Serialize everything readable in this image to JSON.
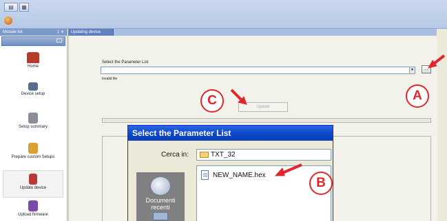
{
  "toolbar": {
    "icon": "app-icon"
  },
  "module_list": {
    "title": "Module list",
    "pin_label": "‡ ✕",
    "items": [
      {
        "label": "Home",
        "icon": "home-icon",
        "color": "#b83a2c"
      },
      {
        "label": "Device setup",
        "icon": "device-setup-icon",
        "color": "#5a6d8c"
      },
      {
        "label": "Setup summary",
        "icon": "summary-icon",
        "color": "#8a8f99"
      },
      {
        "label": "Prepare custom Setups",
        "icon": "custom-setup-icon",
        "color": "#d9a232"
      },
      {
        "label": "Update device",
        "icon": "update-device-icon",
        "color": "#b93a3a"
      },
      {
        "label": "Upload firmware",
        "icon": "upload-firmware-icon",
        "color": "#7a4aa8"
      }
    ]
  },
  "tab": {
    "label": "Updating device"
  },
  "update_pane": {
    "select_label": "Select the Parameter List",
    "combo_value": "",
    "combo_arrow": "▾",
    "browse_label": "...",
    "invalid_text": "Invalid file",
    "update_button": "Update"
  },
  "dialog": {
    "title": "Select the Parameter List",
    "look_in_label": "Cerca in:",
    "look_in_value": "TXT_32",
    "places": [
      {
        "label": "Documenti recenti",
        "icon": "recent-documents-icon"
      }
    ],
    "files": [
      {
        "name": "NEW_NAME.hex",
        "icon": "hex-file-icon"
      }
    ]
  },
  "annotations": {
    "a": "A",
    "b": "B",
    "c": "C",
    "color": "#e1262b"
  }
}
